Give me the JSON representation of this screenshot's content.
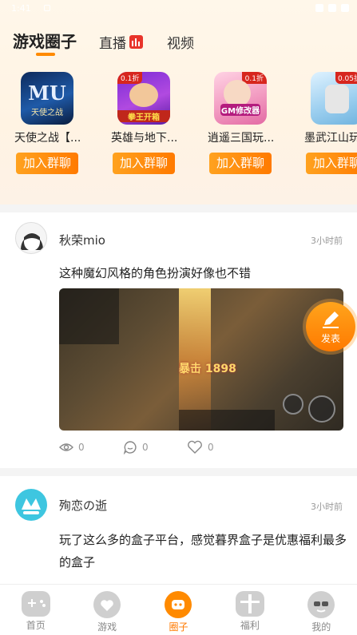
{
  "status_bar": {
    "time": "1:41"
  },
  "tabs": [
    {
      "label": "游戏圈子"
    },
    {
      "label": "直播"
    },
    {
      "label": "视频"
    }
  ],
  "groups": [
    {
      "name": "天使之战【...",
      "button": "加入群聊",
      "icon_text": "MU",
      "icon_sub": "天使之战"
    },
    {
      "name": "英雄与地下...",
      "button": "加入群聊",
      "icon_badge": "0.1折",
      "icon_text": "拳王开箱"
    },
    {
      "name": "逍遥三国玩...",
      "button": "加入群聊",
      "icon_badge": "0.1折",
      "icon_text": "GM修改器"
    },
    {
      "name": "墨武江山玩...",
      "button": "加入群聊",
      "icon_badge": "0.05折"
    }
  ],
  "posts": [
    {
      "user": "秋荣mio",
      "time": "3小时前",
      "content": "这种魔幻风格的角色扮演好像也不错",
      "image_damage_text": "暴击 1898",
      "views": "0",
      "comments": "0",
      "likes": "0"
    },
    {
      "user": "殉恋の逝",
      "time": "3小时前",
      "content": "玩了这么多的盒子平台，感觉暮界盒子是优惠福利最多的盒子"
    }
  ],
  "fab": {
    "label": "发表"
  },
  "nav": [
    {
      "label": "首页"
    },
    {
      "label": "游戏"
    },
    {
      "label": "圈子"
    },
    {
      "label": "福利"
    },
    {
      "label": "我的"
    }
  ],
  "colors": {
    "accent": "#ff8a00",
    "live_badge": "#e8342a"
  }
}
